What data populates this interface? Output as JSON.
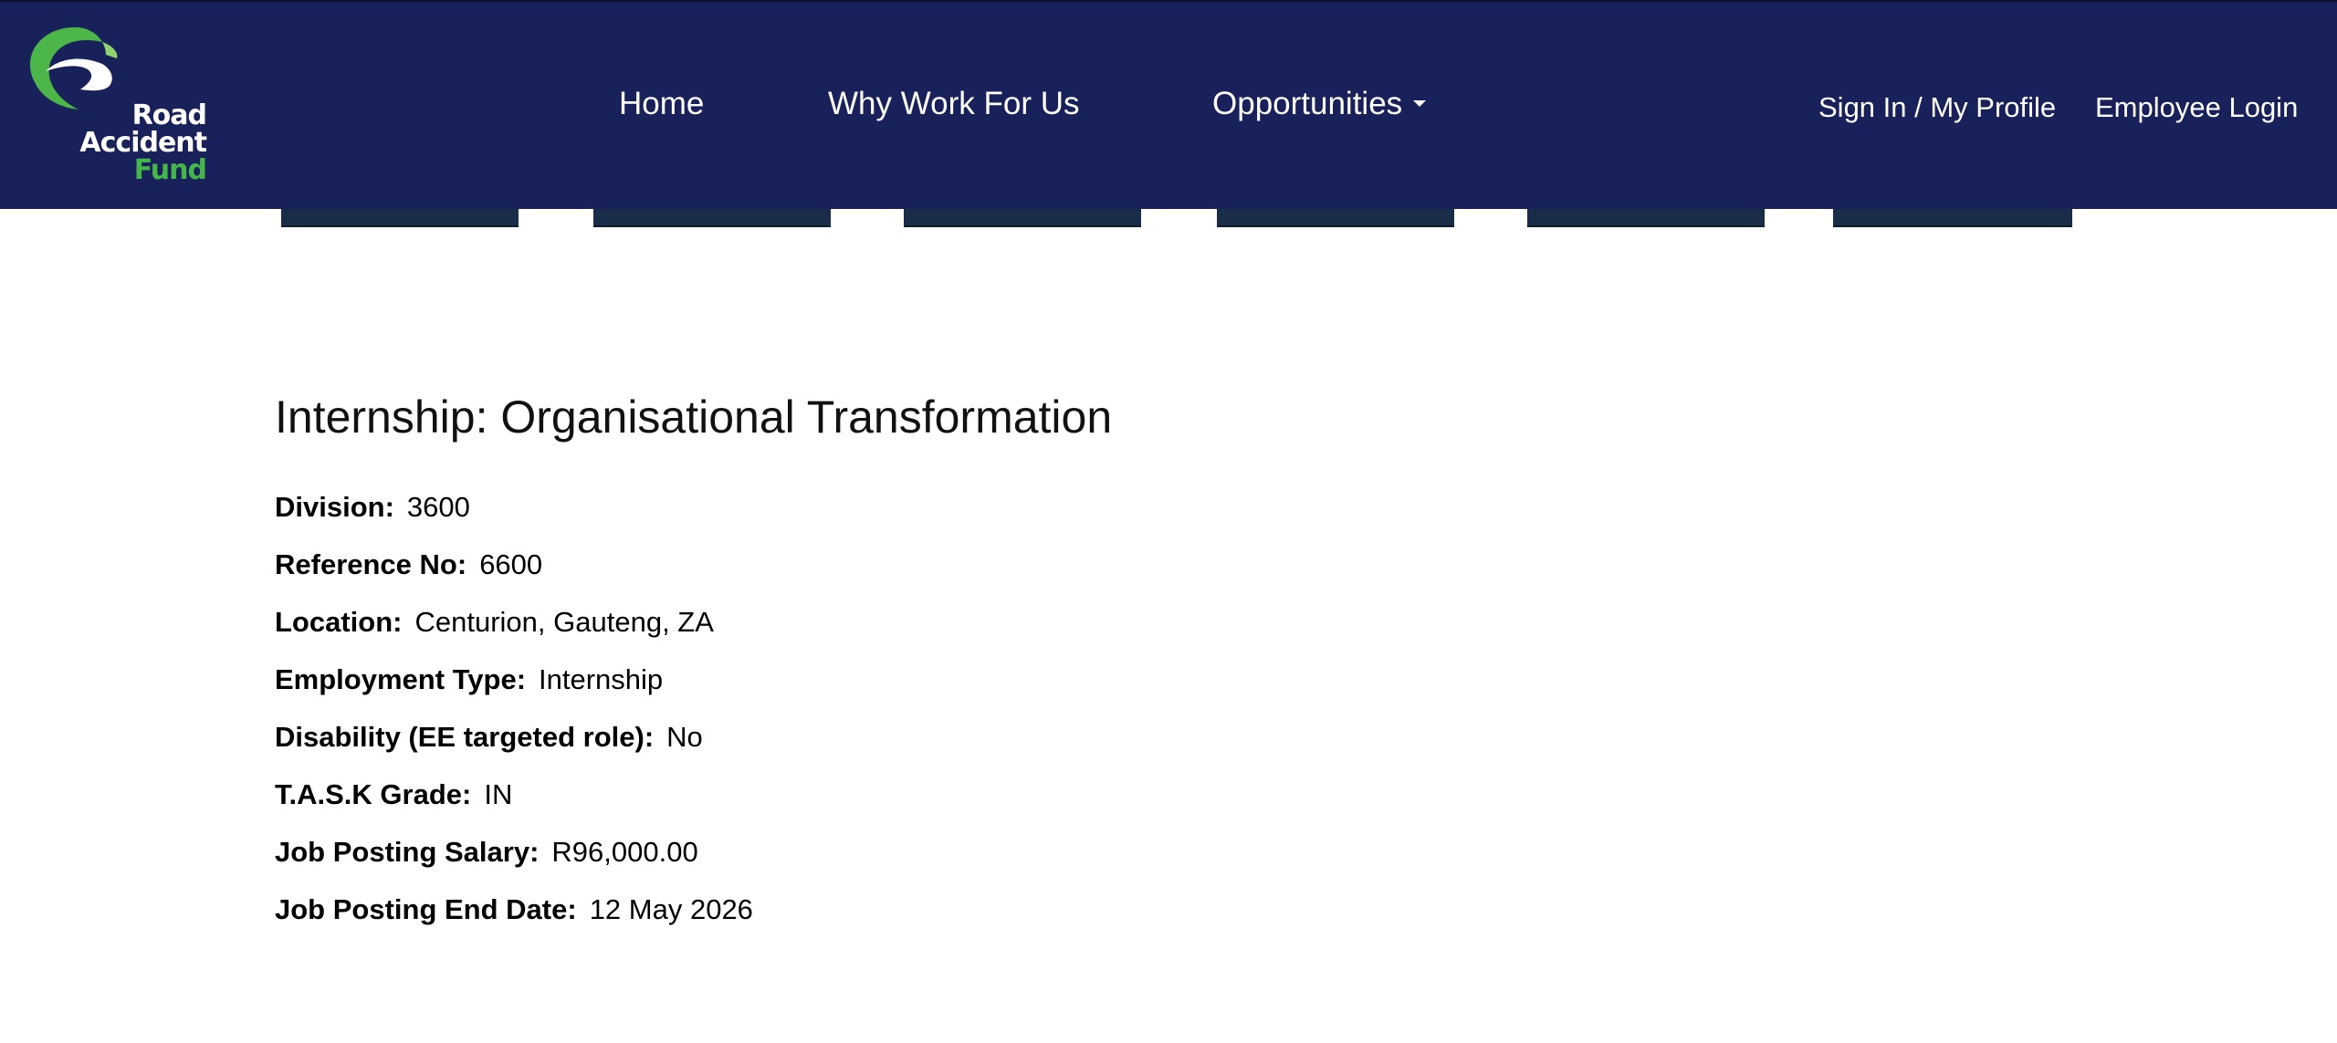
{
  "brand": {
    "logo_lines": [
      "Road",
      "Accident",
      "Fund"
    ],
    "colors": {
      "navbar": "#19215a",
      "logo_green": "#45b649",
      "text_white": "#ffffff"
    }
  },
  "nav": {
    "home": "Home",
    "why_work_for_us": "Why Work For Us",
    "opportunities": "Opportunities",
    "sign_in": "Sign In / My Profile",
    "employee_login": "Employee Login"
  },
  "job": {
    "title": "Internship: Organisational Transformation",
    "details": [
      {
        "label": "Division:",
        "value": "3600"
      },
      {
        "label": "Reference No:",
        "value": "6600"
      },
      {
        "label": "Location:",
        "value": "Centurion, Gauteng, ZA"
      },
      {
        "label": "Employment Type:",
        "value": "Internship"
      },
      {
        "label": "Disability (EE targeted role):",
        "value": "No"
      },
      {
        "label": "T.A.S.K Grade:",
        "value": "IN"
      },
      {
        "label": "Job Posting Salary:",
        "value": "R96,000.00"
      },
      {
        "label": "Job Posting End Date:",
        "value": "12 May 2026"
      }
    ]
  },
  "icons": {
    "logo": "raf-swoosh-logo-icon",
    "dropdown": "caret-down-icon"
  }
}
